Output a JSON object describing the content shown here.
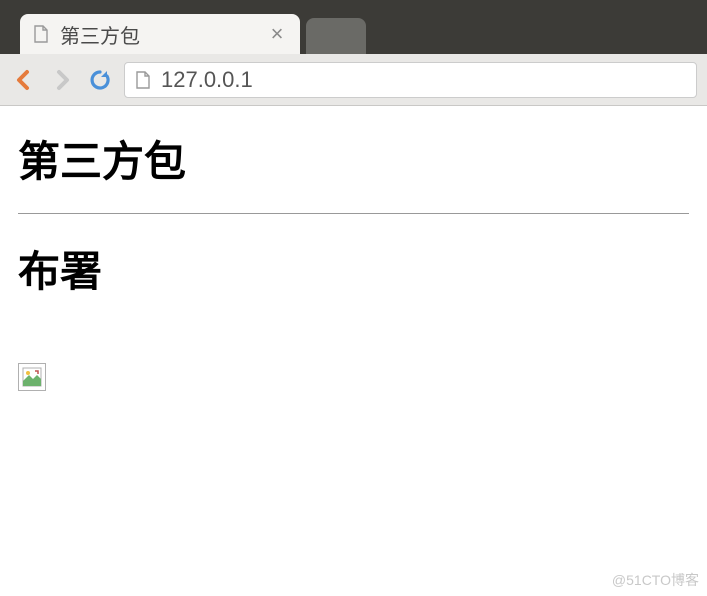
{
  "tab": {
    "title": "第三方包"
  },
  "address": {
    "url": "127.0.0.1"
  },
  "page": {
    "heading1": "第三方包",
    "heading2": "布署"
  },
  "watermark": "@51CTO博客"
}
